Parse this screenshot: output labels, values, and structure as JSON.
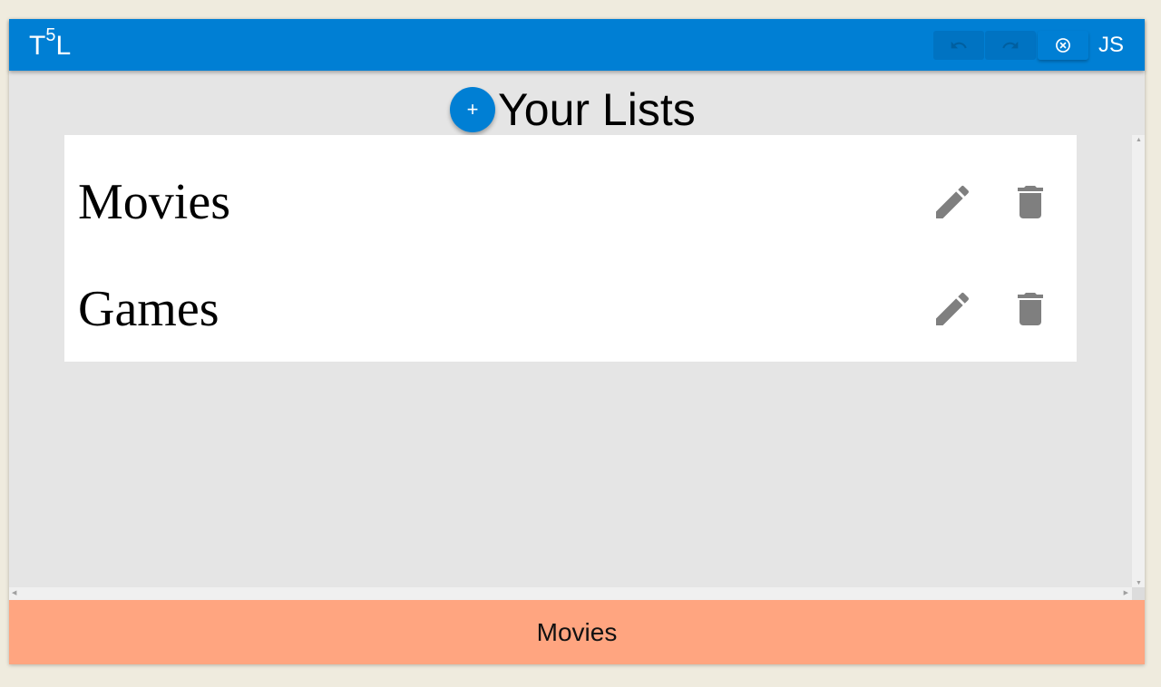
{
  "appbar": {
    "logo_main": "T",
    "logo_sup": "5",
    "logo_end": "L",
    "undo_icon": "undo-icon",
    "redo_icon": "redo-icon",
    "close_icon": "close-circle-icon",
    "user_initials": "JS"
  },
  "main": {
    "add_label": "+",
    "title": "Your Lists",
    "lists": [
      {
        "name": "Movies",
        "edit_icon": "pencil-icon",
        "delete_icon": "trash-icon"
      },
      {
        "name": "Games",
        "edit_icon": "pencil-icon",
        "delete_icon": "trash-icon"
      }
    ]
  },
  "footer": {
    "status": "Movies"
  },
  "colors": {
    "appbar": "#007fd4",
    "background": "#e5e5e5",
    "page": "#efebde",
    "footer": "#ffa580",
    "icon": "#7f7f7f"
  }
}
